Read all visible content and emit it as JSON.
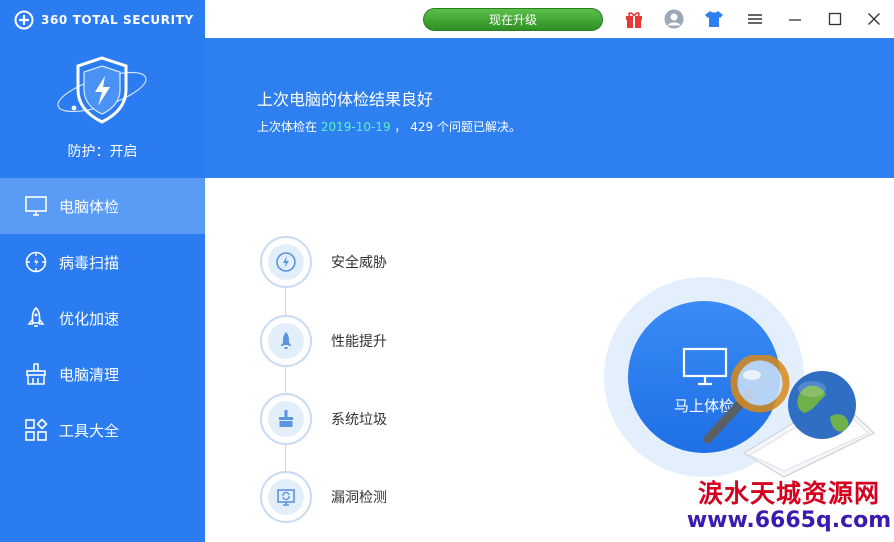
{
  "app": {
    "brand": "360 TOTAL SECURITY",
    "protection_status": "防护：开启"
  },
  "titlebar": {
    "upgrade_label": "现在升级",
    "icons": [
      "gift-icon",
      "avatar-icon",
      "skin-icon",
      "menu-icon",
      "minimize-icon",
      "maximize-icon",
      "close-icon"
    ]
  },
  "sidebar": {
    "items": [
      {
        "label": "电脑体检",
        "icon": "monitor-icon",
        "active": true
      },
      {
        "label": "病毒扫描",
        "icon": "virus-scan-icon",
        "active": false
      },
      {
        "label": "优化加速",
        "icon": "rocket-icon",
        "active": false
      },
      {
        "label": "电脑清理",
        "icon": "broom-icon",
        "active": false
      },
      {
        "label": "工具大全",
        "icon": "toolbox-icon",
        "active": false
      }
    ]
  },
  "banner": {
    "title": "上次电脑的体检结果良好",
    "sub_prefix": "上次体检在",
    "date": "2019-10-19",
    "sub_suffix": "， 429 个问题已解决。"
  },
  "checklist": {
    "items": [
      {
        "label": "安全威胁",
        "icon": "threat-icon"
      },
      {
        "label": "性能提升",
        "icon": "rocket-icon"
      },
      {
        "label": "系统垃圾",
        "icon": "broom-icon"
      },
      {
        "label": "漏洞检测",
        "icon": "patch-icon"
      }
    ]
  },
  "scan": {
    "label": "马上体检"
  },
  "watermark": {
    "line1": "涙水天城资源网",
    "line2": "www.6665q.com"
  },
  "colors": {
    "sidebar": "#2b7cf0",
    "sidebar_active": "#5a9bf5",
    "banner": "#2e80f1",
    "date_highlight": "#5ff0c8",
    "upgrade_green": "#3aa02e"
  }
}
